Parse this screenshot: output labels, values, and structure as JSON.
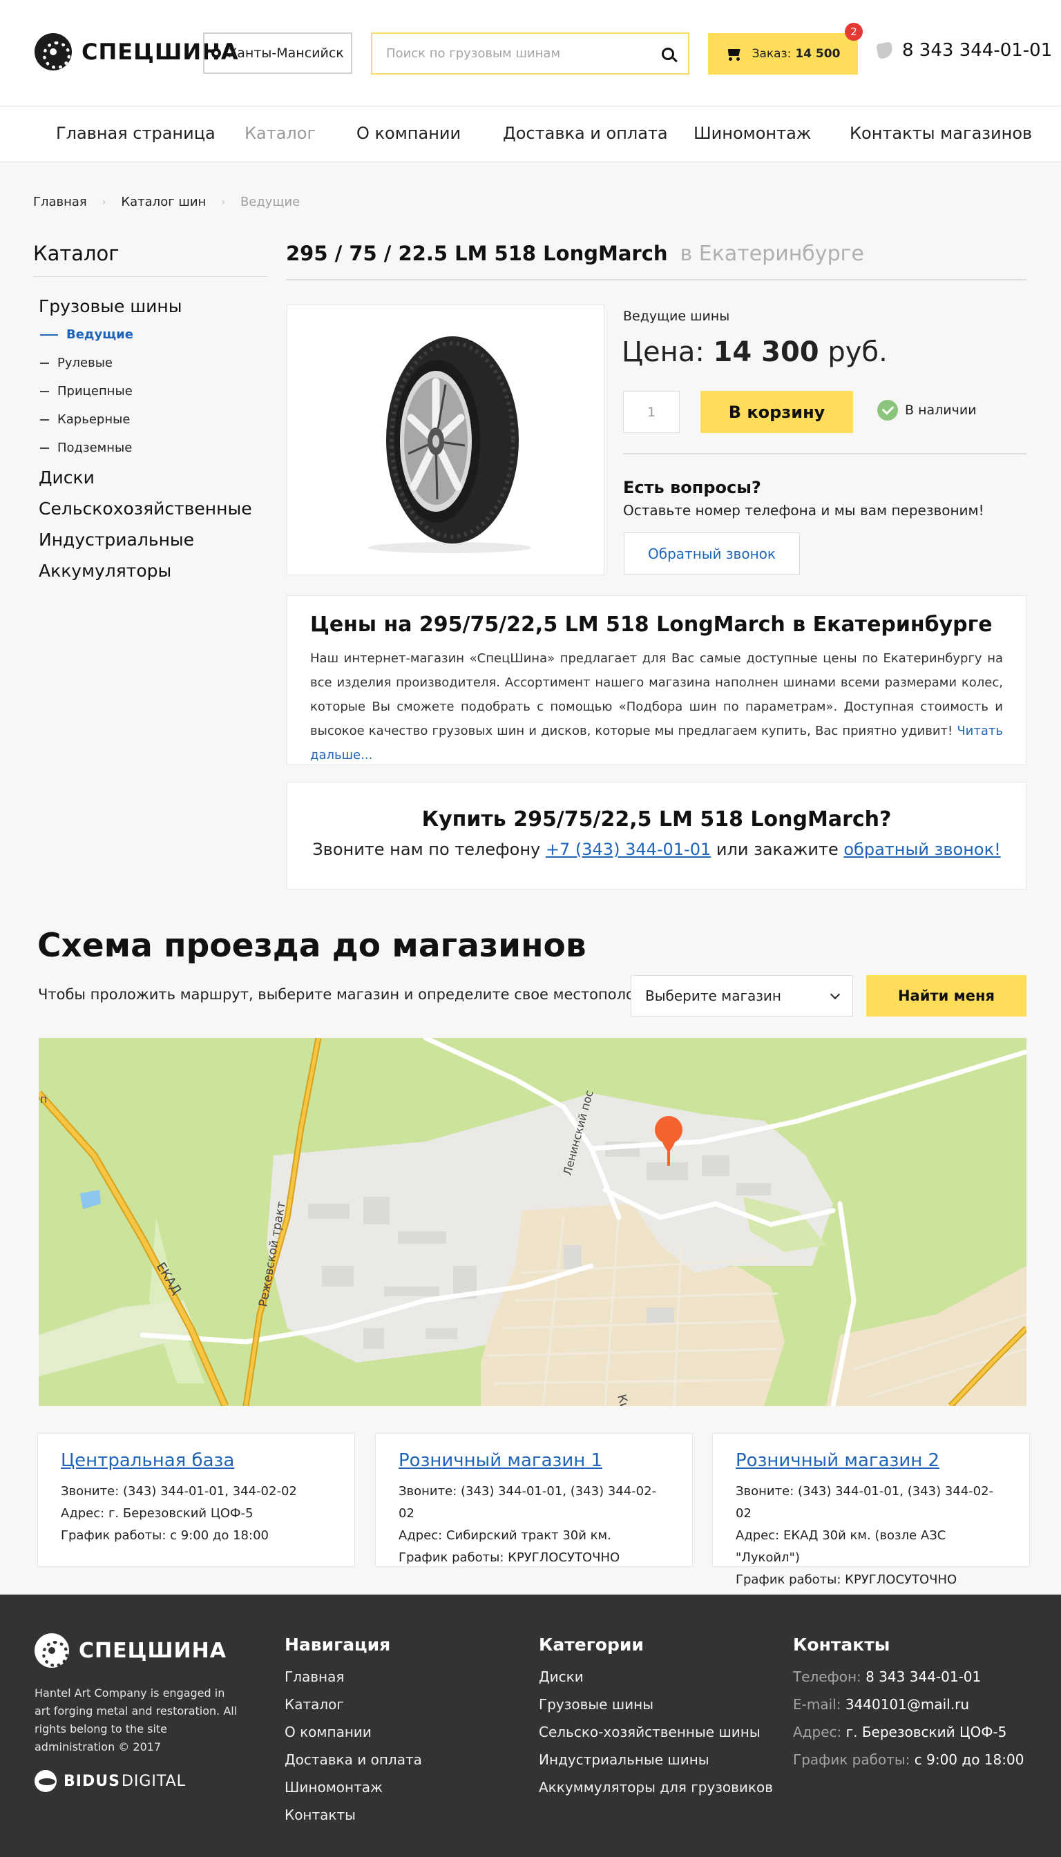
{
  "header": {
    "logo_text": "СПЕЦШИНА",
    "city": "Ханты-Мансийск",
    "search_placeholder": "Поиск по грузовым шинам",
    "cart_label": "Заказ:",
    "cart_total": "14 500",
    "cart_count": "2",
    "phone": "8 343 344-01-01"
  },
  "nav": {
    "items": [
      {
        "label": "Главная страница"
      },
      {
        "label": "Каталог"
      },
      {
        "label": "О компании"
      },
      {
        "label": "Доставка и оплата"
      },
      {
        "label": "Шиномонтаж"
      },
      {
        "label": "Контакты магазинов"
      }
    ],
    "active": "Каталог"
  },
  "breadcrumb": {
    "items": [
      "Главная",
      "Каталог шин",
      "Ведущие"
    ]
  },
  "sidebar": {
    "title": "Каталог",
    "categories": [
      {
        "label": "Грузовые шины"
      },
      {
        "label": "Диски"
      },
      {
        "label": "Сельскохозяйственные"
      },
      {
        "label": "Индустриальные"
      },
      {
        "label": "Аккумуляторы"
      }
    ],
    "subcategories": [
      {
        "label": "Ведущие"
      },
      {
        "label": "Рулевые"
      },
      {
        "label": "Прицепные"
      },
      {
        "label": "Карьерные"
      },
      {
        "label": "Подземные"
      }
    ]
  },
  "product": {
    "title": "295 / 75 / 22.5 LM 518 LongMarch",
    "city": "в Екатеринбурге",
    "category": "Ведущие шины",
    "price_label": "Цена:",
    "price_value": "14 300",
    "price_currency": "руб.",
    "quantity": "1",
    "add_to_cart": "В корзину",
    "stock": "В наличии",
    "questions_title": "Есть вопросы?",
    "questions_text": "Оставьте номер телефона и мы вам перезвоним!",
    "callback_label": "Обратный звонок"
  },
  "info": {
    "title": "Цены на 295/75/22,5 LM 518 LongMarch в Екатеринбурге",
    "text": "Наш интернет-магазин «СпецШина» предлагает для Вас самые доступные цены по Екатеринбургу на все изделия производителя. Ассортимент нашего магазина наполнен шинами всеми размерами колес, которые Вы сможете подобрать с помощью «Подбора шин по параметрам». Доступная стоимость и высокое качество грузовых шин и дисков, которые мы предлагаем купить, Вас приятно удивит! ",
    "more": "Читать дальше..."
  },
  "buy": {
    "title": "Купить 295/75/22,5 LM 518 LongMarch?",
    "text_before": "Звоните нам по телефону ",
    "phone": "+7 (343) 344-01-01",
    "text_middle": " или закажите ",
    "callback": "обратный звонок!"
  },
  "route": {
    "title": "Схема проезда до магазинов",
    "hint": "Чтобы проложить маршрут, выберите магазин и определите свое местоположение:",
    "select_label": "Выберите магазин",
    "find_me": "Найти меня"
  },
  "map": {
    "labels": [
      "ЕКАД",
      "Режевской тракт",
      "Ленинский пос",
      "Кир",
      "п"
    ],
    "colors": {
      "green": "#cbe39a",
      "urban": "#ebe9e6",
      "residential": "#efe4ca",
      "road": "#f6b826",
      "marker": "#f4622e",
      "water": "#8cc6ee"
    }
  },
  "stores": [
    {
      "name": "Центральная база",
      "phones": "Звоните: (343) 344-01-01, 344-02-02",
      "address": "Адрес: г. Березовский ЦОФ-5",
      "hours": "График работы: с 9:00 до 18:00"
    },
    {
      "name": "Розничный магазин 1",
      "phones": "Звоните: (343) 344-01-01, (343) 344-02-02",
      "address": "Адрес: Сибирский тракт 30й км.",
      "hours": "График работы: КРУГЛОСУТОЧНО"
    },
    {
      "name": "Розничный магазин 2",
      "phones": "Звоните: (343) 344-01-01, (343) 344-02-02",
      "address": "Адрес: ЕКАД 30й км. (возле АЗС \"Лукойл\")",
      "hours": "График работы: КРУГЛОСУТОЧНО"
    }
  ],
  "footer": {
    "logo_text": "СПЕЦШИНА",
    "description": "Hantel Art Company is engaged in art forging metal and restoration. All rights belong to the site administration © 2017",
    "developer_bold": "BIDUS",
    "developer_light": "DIGITAL",
    "nav_title": "Навигация",
    "nav_links": [
      "Главная",
      "Каталог",
      "О компании",
      "Доставка и оплата",
      "Шиномонтаж",
      "Контакты"
    ],
    "cat_title": "Категории",
    "cat_links": [
      "Диски",
      "Грузовые шины",
      "Сельско-хозяйственные шины",
      "Индустриальные шины",
      "Аккуммуляторы для грузовиков"
    ],
    "contacts_title": "Контакты",
    "contacts": [
      {
        "label": "Телефон:",
        "value": "8 343 344-01-01"
      },
      {
        "label": "E-mail:",
        "value": "3440101@mail.ru"
      },
      {
        "label": "Адрес:",
        "value": "г. Березовский ЦОФ-5"
      },
      {
        "label": "График работы:",
        "value": "с 9:00 до 18:00"
      }
    ]
  },
  "colors": {
    "accent": "#fedd5b",
    "link": "#1e64b9",
    "footer_bg": "#333333",
    "badge": "#e53935",
    "stock": "#8bc47d"
  }
}
